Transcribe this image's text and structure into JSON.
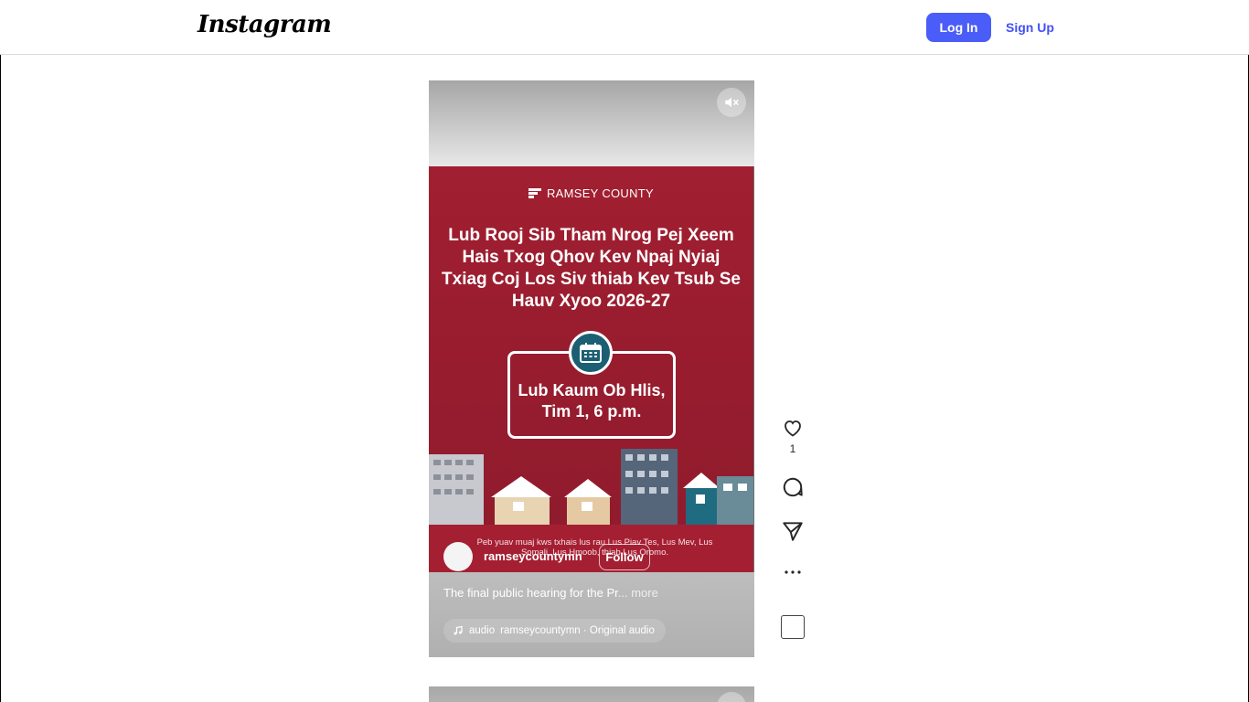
{
  "header": {
    "logo_text": "Instagram",
    "login_label": "Log In",
    "signup_label": "Sign Up",
    "login_color": "#4a5df9"
  },
  "reel": {
    "poster": {
      "county": "RAMSEY COUNTY",
      "title": "Lub Rooj Sib Tham Nrog Pej Xeem Hais Txog Qhov Kev Npaj Nyiaj Txiag Coj Los Siv thiab Kev Tsub Se Hauv Xyoo 2026-27",
      "event_line1": "Lub Kaum Ob Hlis,",
      "event_line2": "Tim 1, 6 p.m.",
      "footer_text": "Peb yuav muaj kws txhais lus rau Lus Piav Tes, Lus Mev, Lus Somali, Lus Hmoob, thiab Lus Oromo.",
      "background_color": "#9c1e30"
    },
    "username": "ramseycountymn",
    "follow_label": "Follow",
    "caption": "The final public hearing for the Pr",
    "caption_more": "... more",
    "audio_label": "audio",
    "audio_text": "ramseycountymn · Original audio",
    "mute_icon": "speaker-muted-icon"
  },
  "actions": {
    "like_count": "1",
    "icons": [
      "heart-icon",
      "comment-icon",
      "share-icon",
      "more-icon"
    ]
  }
}
